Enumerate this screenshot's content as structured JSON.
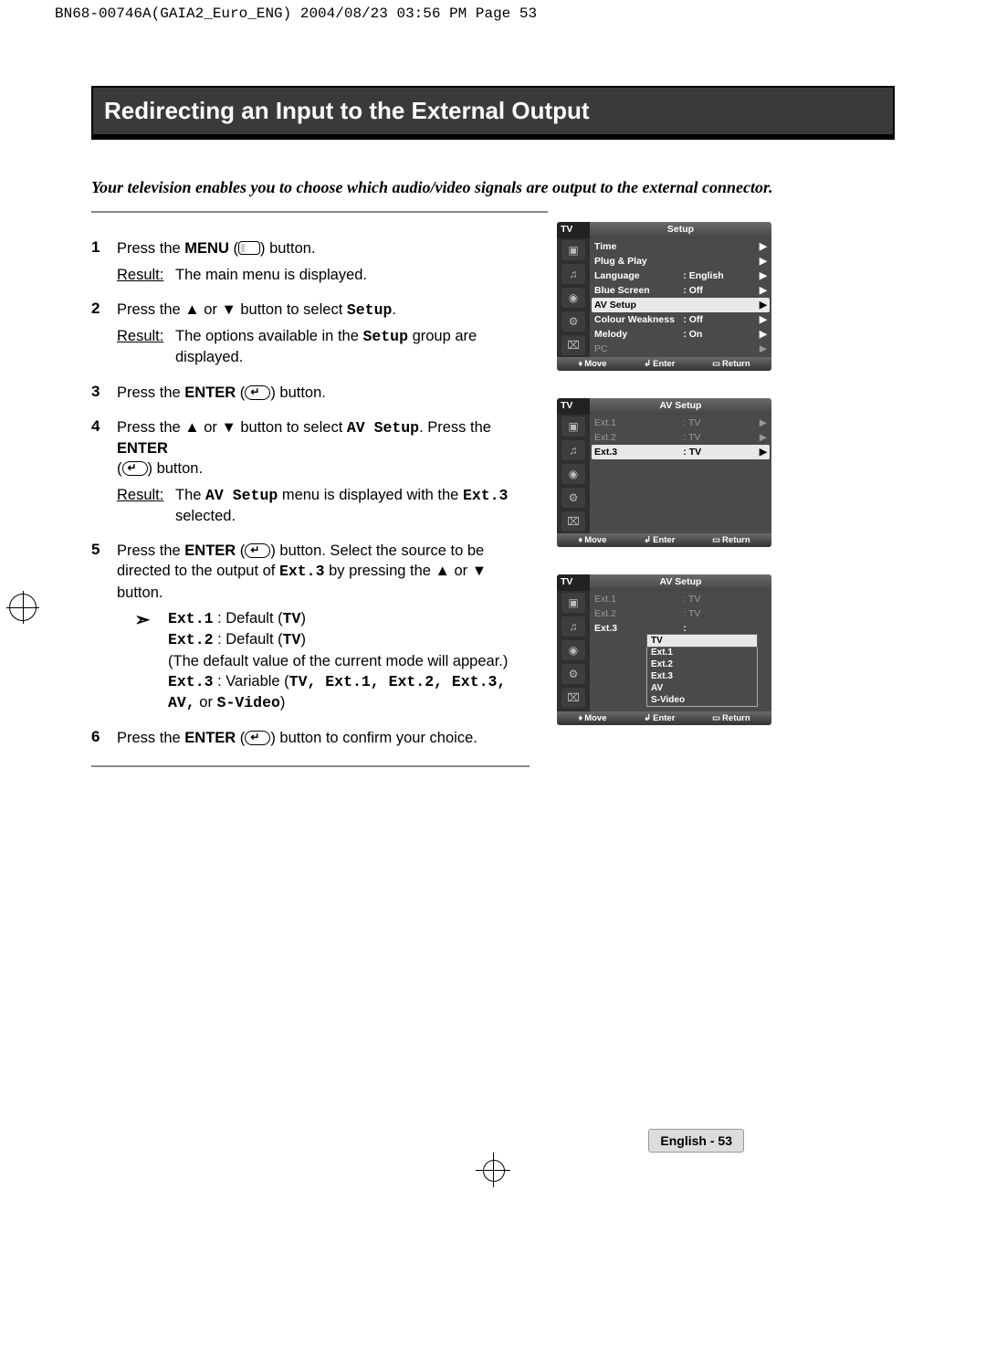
{
  "header_line": "BN68-00746A(GAIA2_Euro_ENG)  2004/08/23  03:56 PM  Page 53",
  "title": "Redirecting an Input to the External Output",
  "intro": "Your television enables you to choose which audio/video signals are output to the external connector.",
  "steps": {
    "s1": {
      "num": "1",
      "pre": "Press the ",
      "bold": "MENU",
      "post": " (",
      "post2": ") button.",
      "result_label": "Result:",
      "result": "The main menu is displayed."
    },
    "s2": {
      "num": "2",
      "pre": "Press the ▲ or ▼ button to select ",
      "mono": "Setup",
      "post": ".",
      "result_label": "Result:",
      "result_a": "The options available in the ",
      "result_mono": "Setup",
      "result_b": " group are displayed."
    },
    "s3": {
      "num": "3",
      "pre": "Press the ",
      "bold": "ENTER",
      "post": " (",
      "post2": ") button."
    },
    "s4": {
      "num": "4",
      "pre": "Press the ▲ or ▼ button to select ",
      "mono": "AV Setup",
      "mid": ". Press the ",
      "bold": "ENTER",
      "post": " (",
      "post2": ") button.",
      "result_label": "Result:",
      "result_a": "The ",
      "result_mono": "AV Setup",
      "result_b": " menu is displayed with the ",
      "result_mono2": "Ext.3",
      "result_c": " selected."
    },
    "s5": {
      "num": "5",
      "pre": "Press the ",
      "bold": "ENTER",
      "post": " (",
      "mid": ") button. Select the source to be directed to the output of ",
      "mono": "Ext.3",
      "mid2": " by pressing the ▲ or ▼ button.",
      "note_arrow": "➣",
      "ext1_l": "Ext.1",
      "ext1_m": " : Default (",
      "ext1_v": "TV",
      "ext1_r": ")",
      "ext2_l": "Ext.2",
      "ext2_m": " : Default (",
      "ext2_v": "TV",
      "ext2_r": ")",
      "note_line3": "(The default value of the current mode will appear.)",
      "ext3_l": "Ext.3",
      "ext3_m": " : Variable (",
      "ext3_v": "TV, Ext.1, Ext.2, Ext.3, AV,",
      "ext3_or": " or ",
      "ext3_sv": "S-Video",
      "ext3_r": ")"
    },
    "s6": {
      "num": "6",
      "pre": "Press the ",
      "bold": "ENTER",
      "post": " (",
      "post2": ") button to confirm your choice."
    }
  },
  "osd1": {
    "tv": "TV",
    "title": "Setup",
    "rows": [
      {
        "lbl": "Time",
        "val": "",
        "arr": "▶"
      },
      {
        "lbl": "Plug & Play",
        "val": "",
        "arr": "▶"
      },
      {
        "lbl": "Language",
        "val": ": English",
        "arr": "▶"
      },
      {
        "lbl": "Blue Screen",
        "val": ": Off",
        "arr": "▶"
      },
      {
        "lbl": "AV Setup",
        "val": "",
        "arr": "▶",
        "sel": true
      },
      {
        "lbl": "Colour Weakness",
        "val": ": Off",
        "arr": "▶"
      },
      {
        "lbl": "Melody",
        "val": ": On",
        "arr": "▶"
      },
      {
        "lbl": "PC",
        "val": "",
        "arr": "▶",
        "dim": true
      }
    ],
    "footer": {
      "move": "Move",
      "enter": "Enter",
      "return": "Return"
    }
  },
  "osd2": {
    "tv": "TV",
    "title": "AV Setup",
    "rows": [
      {
        "lbl": "Ext.1",
        "val": ": TV",
        "arr": "▶",
        "dim": true
      },
      {
        "lbl": "Ext.2",
        "val": ": TV",
        "arr": "▶",
        "dim": true
      },
      {
        "lbl": "Ext.3",
        "val": ": TV",
        "arr": "▶",
        "sel": true
      }
    ],
    "footer": {
      "move": "Move",
      "enter": "Enter",
      "return": "Return"
    }
  },
  "osd3": {
    "tv": "TV",
    "title": "AV Setup",
    "rows": [
      {
        "lbl": "Ext.1",
        "val": ": TV",
        "arr": "",
        "dim": true
      },
      {
        "lbl": "Ext.2",
        "val": ": TV",
        "arr": "",
        "dim": true
      },
      {
        "lbl": "Ext.3",
        "val": ":",
        "arr": ""
      }
    ],
    "sub": [
      "TV",
      "Ext.1",
      "Ext.2",
      "Ext.3",
      "AV",
      "S-Video"
    ],
    "footer": {
      "move": "Move",
      "enter": "Enter",
      "return": "Return"
    }
  },
  "footer_label": "English - 53",
  "nav_icons": {
    "updown": "⧎",
    "enter": "↲",
    "return": "▭"
  }
}
